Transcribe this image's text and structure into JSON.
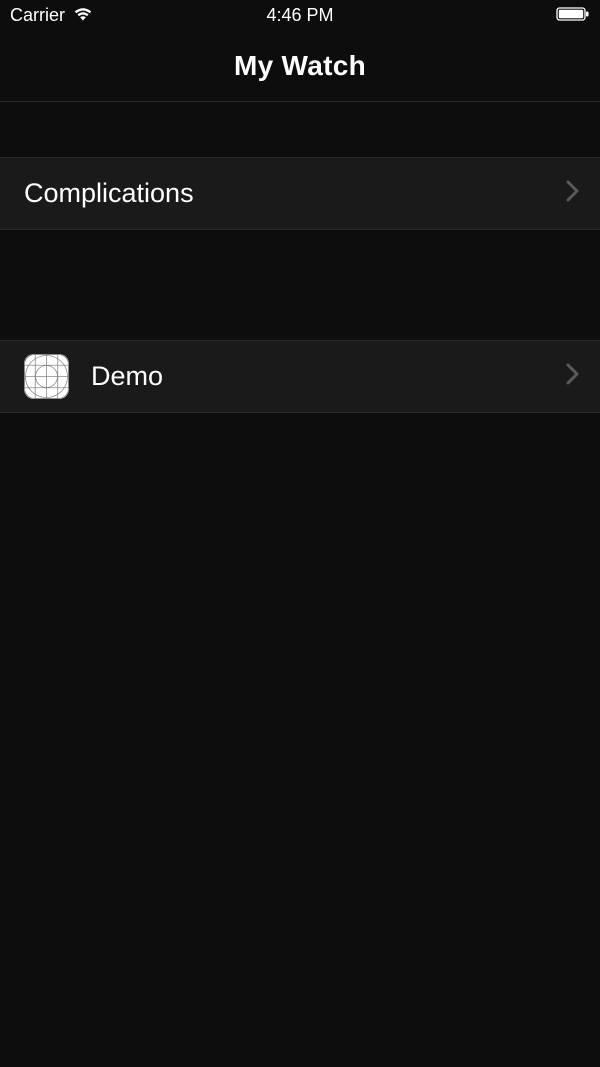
{
  "status_bar": {
    "carrier": "Carrier",
    "time": "4:46 PM"
  },
  "nav": {
    "title": "My Watch"
  },
  "cells": [
    {
      "label": "Complications",
      "has_icon": false
    },
    {
      "label": "Demo",
      "has_icon": true
    }
  ]
}
